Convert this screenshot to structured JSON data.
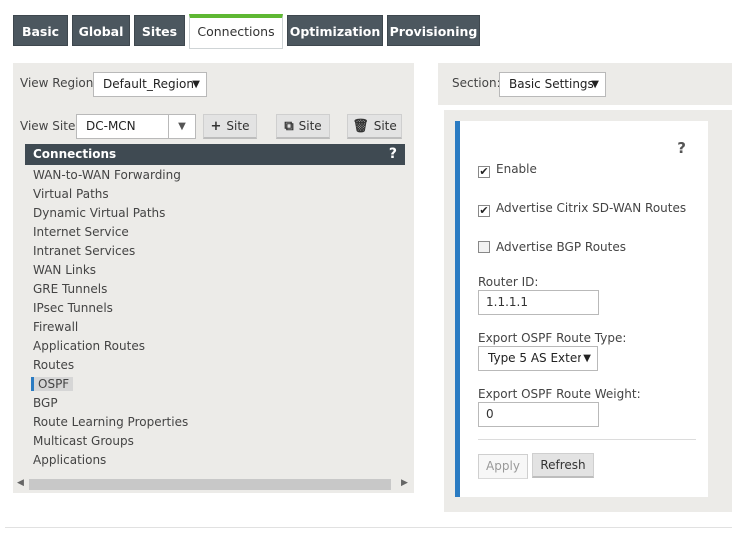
{
  "tabs": [
    {
      "label": "Basic"
    },
    {
      "label": "Global"
    },
    {
      "label": "Sites"
    },
    {
      "label": "Connections",
      "active": true
    },
    {
      "label": "Optimization"
    },
    {
      "label": "Provisioning"
    }
  ],
  "left": {
    "view_region_label": "View Region:",
    "view_region_value": "Default_Region",
    "view_site_label": "View Site:",
    "view_site_value": "DC-MCN",
    "add_site_label": "Site",
    "clone_site_label": "Site",
    "delete_site_label": "Site",
    "connections_header": "Connections",
    "help": "?",
    "tree_items": [
      "WAN-to-WAN Forwarding",
      "Virtual Paths",
      "Dynamic Virtual Paths",
      "Internet Service",
      "Intranet Services",
      "WAN Links",
      "GRE Tunnels",
      "IPsec Tunnels",
      "Firewall",
      "Application Routes",
      "Routes",
      "OSPF",
      "BGP",
      "Route Learning Properties",
      "Multicast Groups",
      "Applications"
    ],
    "selected_item": "OSPF"
  },
  "right": {
    "section_label": "Section:",
    "section_value": "Basic Settings",
    "help": "?",
    "enable_label": "Enable",
    "enable_checked": true,
    "advertise_citrix_label": "Advertise Citrix SD-WAN Routes",
    "advertise_citrix_checked": true,
    "advertise_bgp_label": "Advertise BGP Routes",
    "advertise_bgp_checked": false,
    "router_id_label": "Router ID:",
    "router_id_value": "1.1.1.1",
    "export_type_label": "Export OSPF Route Type:",
    "export_type_value": "Type 5 AS Exterr",
    "export_weight_label": "Export OSPF Route Weight:",
    "export_weight_value": "0",
    "apply_label": "Apply",
    "refresh_label": "Refresh"
  },
  "colors": {
    "tab_bg": "#4c575f",
    "active_tab_accent": "#5fb833",
    "header_bg": "#3f4a52",
    "selection_accent": "#2a7bc2",
    "panel_bg": "#ecebe8"
  }
}
